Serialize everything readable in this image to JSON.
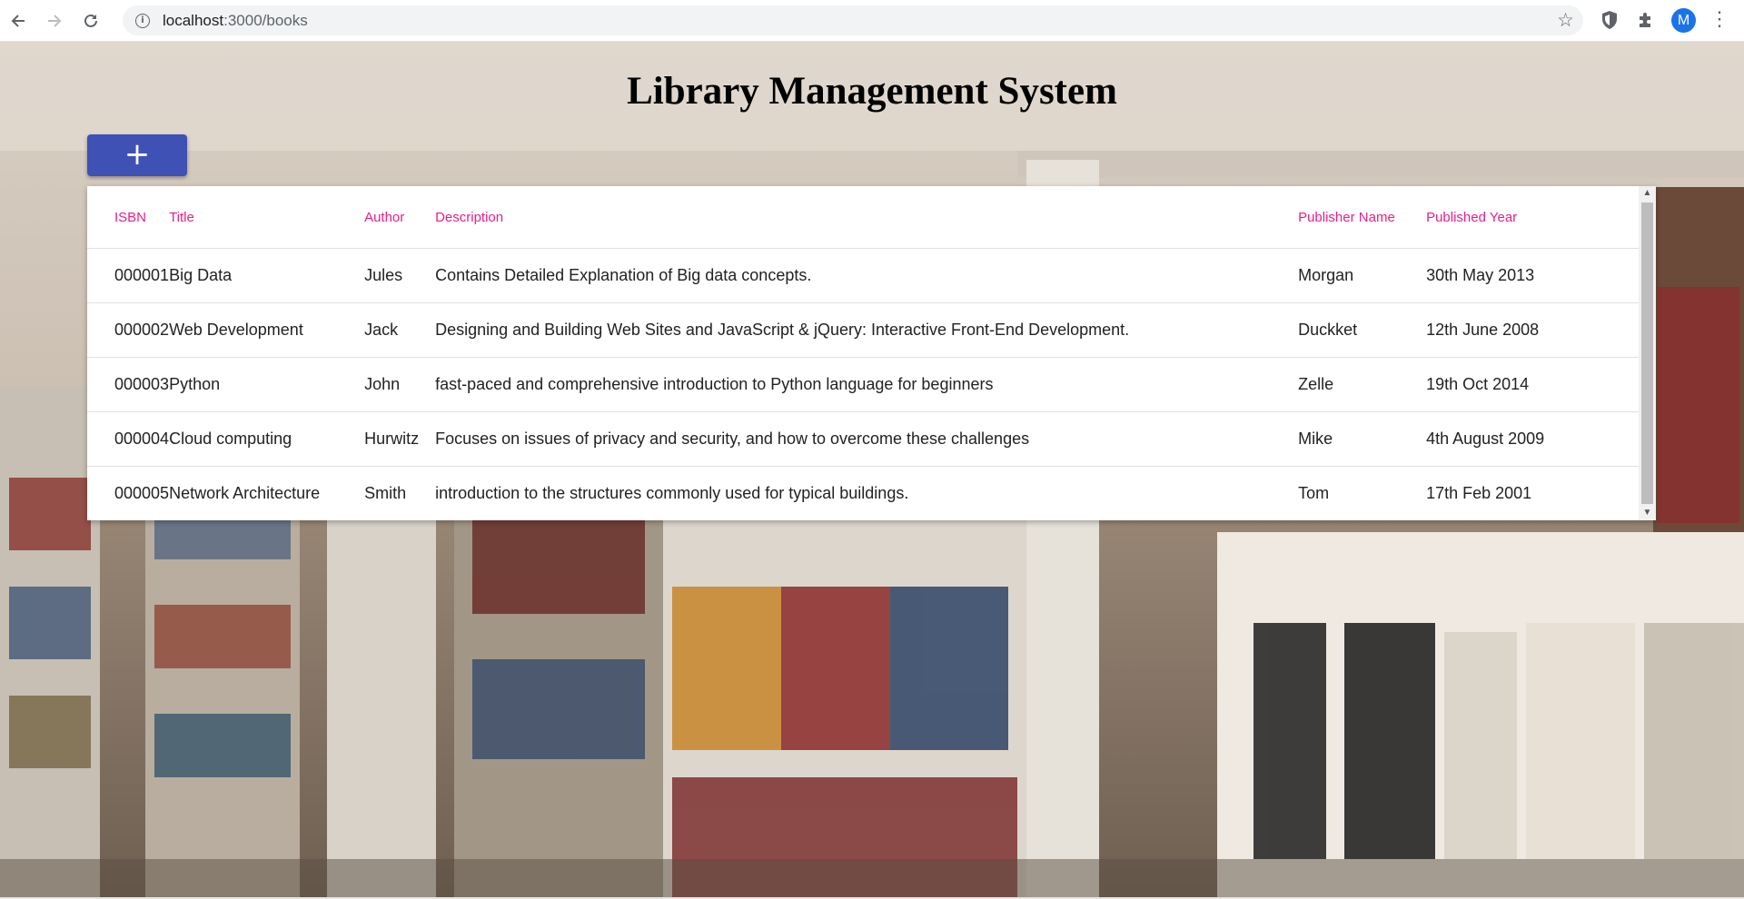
{
  "browser": {
    "url_host": "localhost",
    "url_path": ":3000/books",
    "profile_initial": "M"
  },
  "header": {
    "title": "Library Management System",
    "add_label": "+"
  },
  "table": {
    "columns": {
      "isbn": "ISBN",
      "title": "Title",
      "author": "Author",
      "description": "Description",
      "publisher": "Publisher Name",
      "year": "Published Year"
    },
    "rows": [
      {
        "isbn": "000001",
        "title": "Big Data",
        "author": "Jules",
        "description": "Contains Detailed Explanation of Big data concepts.",
        "publisher": "Morgan",
        "year": "30th May 2013"
      },
      {
        "isbn": "000002",
        "title": "Web Development",
        "author": "Jack",
        "description": "Designing and Building Web Sites and JavaScript & jQuery: Interactive Front-End Development.",
        "publisher": "Duckket",
        "year": "12th June 2008"
      },
      {
        "isbn": "000003",
        "title": "Python",
        "author": "John",
        "description": "fast-paced and comprehensive introduction to Python language for beginners",
        "publisher": "Zelle",
        "year": "19th Oct 2014"
      },
      {
        "isbn": "000004",
        "title": "Cloud computing",
        "author": "Hurwitz",
        "description": "Focuses on issues of privacy and security, and how to overcome these challenges",
        "publisher": "Mike",
        "year": "4th August 2009"
      },
      {
        "isbn": "000005",
        "title": "Network Architecture",
        "author": "Smith",
        "description": "introduction to the structures commonly used for typical buildings.",
        "publisher": "Tom",
        "year": "17th Feb 2001"
      }
    ]
  },
  "colors": {
    "accent": "#3f51b5",
    "header_text": "#e91e8c"
  },
  "icons": {
    "back": "back-arrow-icon",
    "forward": "forward-arrow-icon",
    "reload": "reload-icon",
    "info": "info-icon",
    "star": "star-icon",
    "shield": "shield-icon",
    "puzzle": "puzzle-icon",
    "menu": "kebab-menu-icon"
  }
}
